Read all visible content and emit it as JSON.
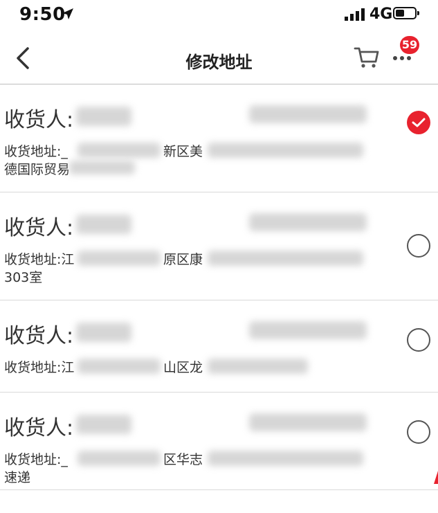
{
  "status_bar": {
    "time": "9:50",
    "network": "4G",
    "location_icon": "location-arrow-icon",
    "signal_icon": "signal-bars-icon",
    "battery_icon": "battery-icon"
  },
  "nav": {
    "back_icon": "chevron-left-icon",
    "title": "修改地址",
    "cart_icon": "cart-icon",
    "more_icon": "more-dots-icon",
    "badge_count": "59"
  },
  "addresses": [
    {
      "recipient_label": "收货人:",
      "address_label": "收货地址:",
      "address_prefix": "_",
      "address_mid": "新区美",
      "address_line2": "德国际贸易",
      "selected": true
    },
    {
      "recipient_label": "收货人:",
      "address_label": "收货地址:",
      "address_prefix": "江",
      "address_mid": "原区康",
      "address_line2": "303室",
      "selected": false
    },
    {
      "recipient_label": "收货人:",
      "address_label": "收货地址:",
      "address_prefix": "江",
      "address_mid": "山区龙",
      "address_line2": "",
      "selected": false
    },
    {
      "recipient_label": "收货人:",
      "address_label": "收货地址:",
      "address_prefix": "_",
      "address_mid": "区华志",
      "address_line2": "速递",
      "selected": false
    }
  ],
  "colors": {
    "accent": "#e8222e",
    "divider": "#d9d9d9"
  }
}
